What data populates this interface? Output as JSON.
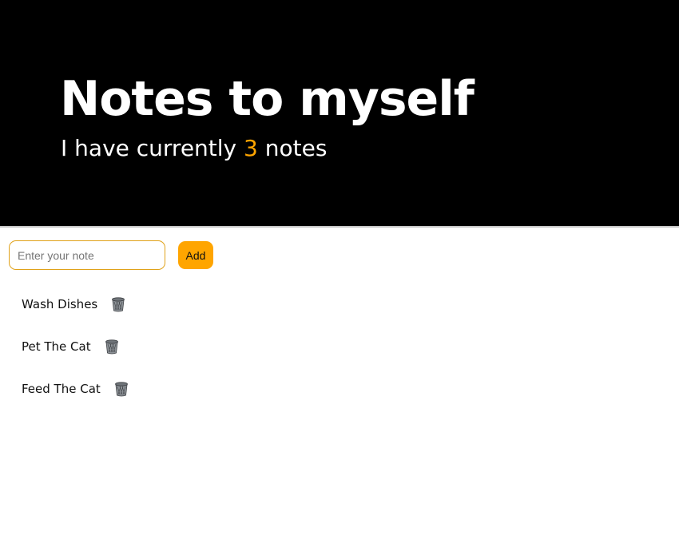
{
  "header": {
    "title": "Notes to myself",
    "subtitle_prefix": "I have currently",
    "count": "3",
    "subtitle_suffix": "notes"
  },
  "form": {
    "input_placeholder": "Enter your note",
    "input_value": "",
    "add_label": "Add"
  },
  "notes": [
    {
      "text": "Wash Dishes",
      "icon": "trash-icon"
    },
    {
      "text": "Pet The Cat",
      "icon": "trash-icon"
    },
    {
      "text": "Feed The Cat",
      "icon": "trash-icon"
    }
  ],
  "colors": {
    "header_bg": "#000000",
    "accent": "#ffa500",
    "header_text": "#ffffff"
  }
}
